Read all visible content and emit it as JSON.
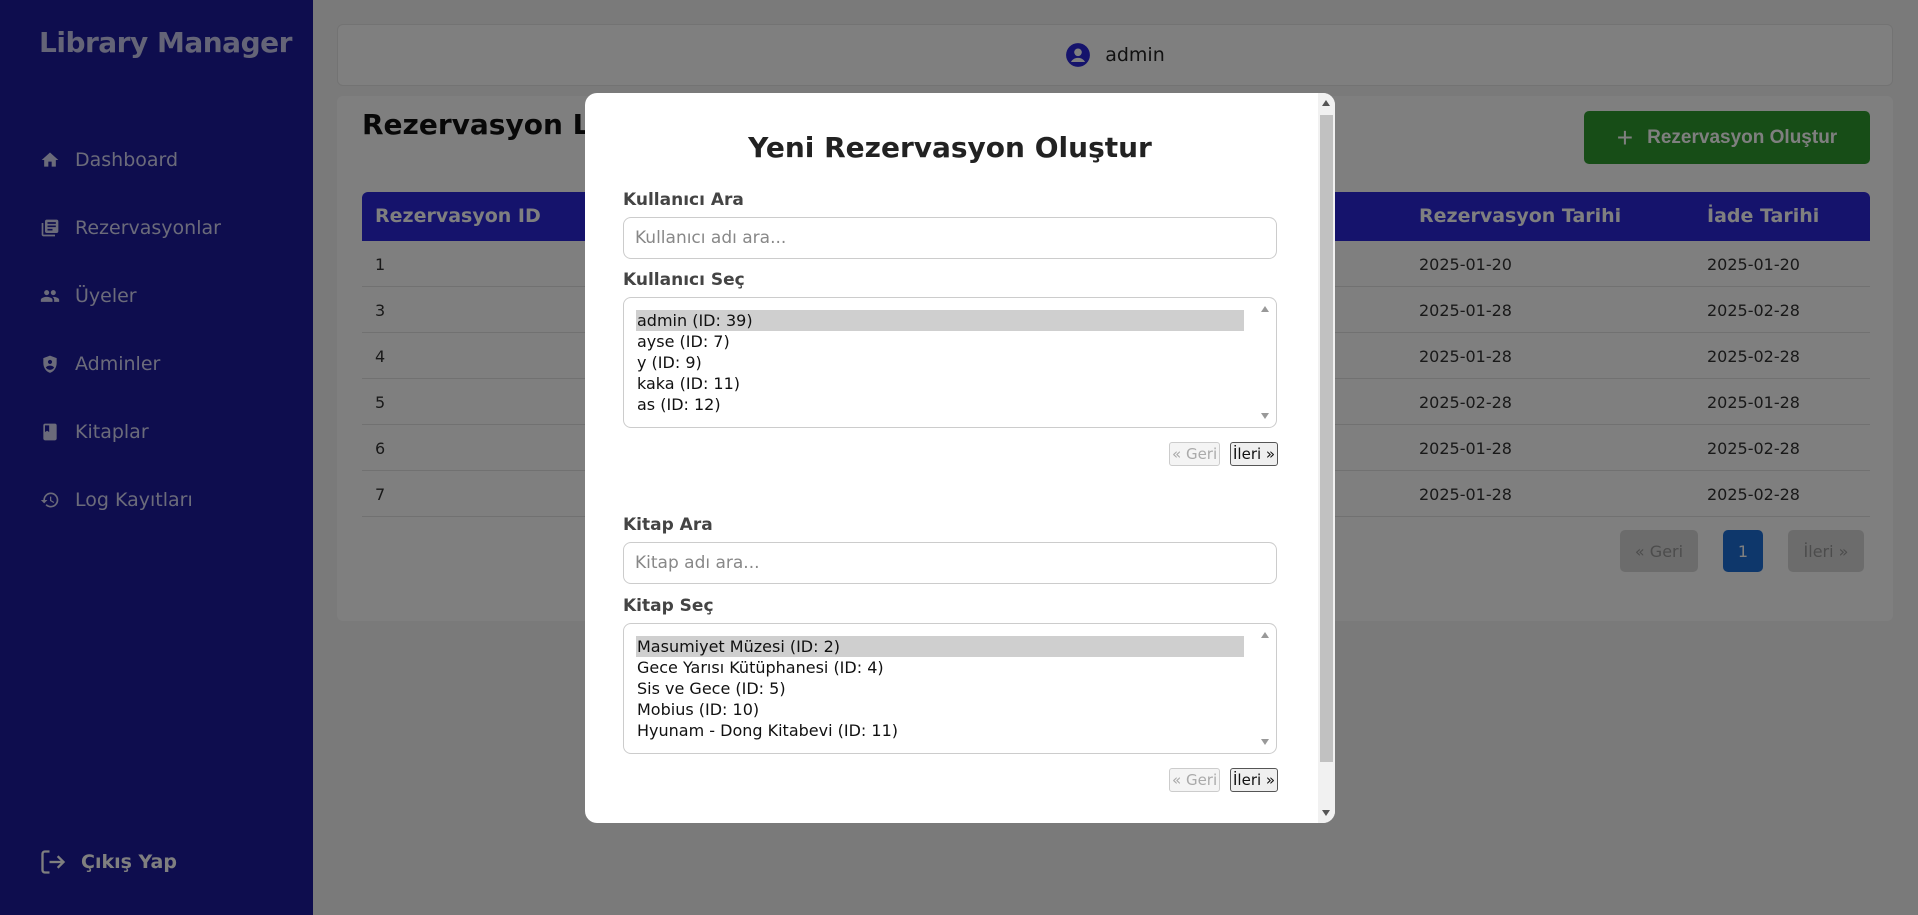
{
  "app": {
    "brand": "Library Manager"
  },
  "sidebar": {
    "items": [
      {
        "label": "Dashboard",
        "icon": "home-icon"
      },
      {
        "label": "Rezervasyonlar",
        "icon": "list-icon"
      },
      {
        "label": "Üyeler",
        "icon": "users-icon"
      },
      {
        "label": "Adminler",
        "icon": "admin-icon"
      },
      {
        "label": "Kitaplar",
        "icon": "book-icon"
      },
      {
        "label": "Log Kayıtları",
        "icon": "history-icon"
      }
    ],
    "logout_label": "Çıkış Yap"
  },
  "topbar": {
    "username": "admin"
  },
  "main": {
    "title": "Rezervasyon Lis",
    "create_button": "Rezervasyon Oluştur",
    "table": {
      "headers": [
        "Rezervasyon ID",
        "Rezervasyon Tarihi",
        "İade Tarihi"
      ],
      "rows": [
        [
          "1",
          "2025-01-20",
          "2025-01-20"
        ],
        [
          "3",
          "2025-01-28",
          "2025-02-28"
        ],
        [
          "4",
          "2025-01-28",
          "2025-02-28"
        ],
        [
          "5",
          "2025-02-28",
          "2025-01-28"
        ],
        [
          "6",
          "2025-01-28",
          "2025-02-28"
        ],
        [
          "7",
          "2025-01-28",
          "2025-02-28"
        ]
      ]
    },
    "pagination": {
      "prev": "« Geri",
      "current": "1",
      "next": "İleri »"
    }
  },
  "modal": {
    "title": "Yeni Rezervasyon Oluştur",
    "user_search": {
      "label": "Kullanıcı Ara",
      "placeholder": "Kullanıcı adı ara..."
    },
    "user_select": {
      "label": "Kullanıcı Seç",
      "options": [
        "admin (ID: 39)",
        "ayse (ID: 7)",
        "y (ID: 9)",
        "kaka (ID: 11)",
        "as (ID: 12)"
      ],
      "selected": "admin (ID: 39)"
    },
    "user_pager": {
      "prev": "« Geri",
      "next": "İleri »"
    },
    "book_search": {
      "label": "Kitap Ara",
      "placeholder": "Kitap adı ara..."
    },
    "book_select": {
      "label": "Kitap Seç",
      "options": [
        "Masumiyet Müzesi (ID: 2)",
        "Gece Yarısı Kütüphanesi (ID: 4)",
        "Sis ve Gece (ID: 5)",
        "Mobius (ID: 10)",
        "Hyunam - Dong Kitabevi (ID: 11)"
      ],
      "selected": "Masumiyet Müzesi (ID: 2)"
    },
    "book_pager": {
      "prev": "« Geri",
      "next": "İleri »"
    }
  },
  "colors": {
    "sidebar": "#1c1a9c",
    "table_header": "#2b27d8",
    "create_button": "#2e9b2e",
    "page_active": "#1c6fd6"
  }
}
